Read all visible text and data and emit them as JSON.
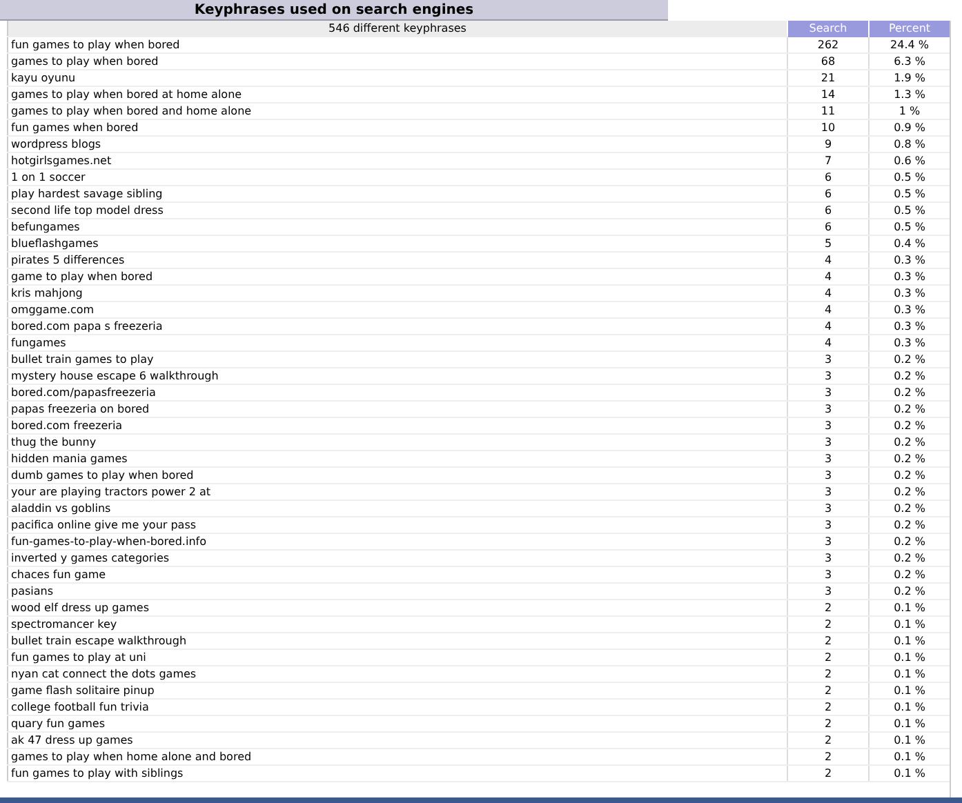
{
  "title": "Keyphrases used on search engines",
  "table": {
    "columns": [
      "546 different keyphrases",
      "Search",
      "Percent"
    ],
    "rows": [
      [
        "fun games to play when bored",
        "262",
        "24.4 %"
      ],
      [
        "games to play when bored",
        "68",
        "6.3 %"
      ],
      [
        "kayu oyunu",
        "21",
        "1.9 %"
      ],
      [
        "games to play when bored at home alone",
        "14",
        "1.3 %"
      ],
      [
        "games to play when bored and home alone",
        "11",
        "1 %"
      ],
      [
        "fun games when bored",
        "10",
        "0.9 %"
      ],
      [
        "wordpress blogs",
        "9",
        "0.8 %"
      ],
      [
        "hotgirlsgames.net",
        "7",
        "0.6 %"
      ],
      [
        "1 on 1 soccer",
        "6",
        "0.5 %"
      ],
      [
        "play hardest savage sibling",
        "6",
        "0.5 %"
      ],
      [
        "second life top model dress",
        "6",
        "0.5 %"
      ],
      [
        "befungames",
        "6",
        "0.5 %"
      ],
      [
        "blueflashgames",
        "5",
        "0.4 %"
      ],
      [
        "pirates 5 differences",
        "4",
        "0.3 %"
      ],
      [
        "game to play when bored",
        "4",
        "0.3 %"
      ],
      [
        "kris mahjong",
        "4",
        "0.3 %"
      ],
      [
        "omggame.com",
        "4",
        "0.3 %"
      ],
      [
        "bored.com papa s freezeria",
        "4",
        "0.3 %"
      ],
      [
        "fungames",
        "4",
        "0.3 %"
      ],
      [
        "bullet train games to play",
        "3",
        "0.2 %"
      ],
      [
        "mystery house escape 6 walkthrough",
        "3",
        "0.2 %"
      ],
      [
        "bored.com/papasfreezeria",
        "3",
        "0.2 %"
      ],
      [
        "papas freezeria on bored",
        "3",
        "0.2 %"
      ],
      [
        "bored.com freezeria",
        "3",
        "0.2 %"
      ],
      [
        "thug the bunny",
        "3",
        "0.2 %"
      ],
      [
        "hidden mania games",
        "3",
        "0.2 %"
      ],
      [
        "dumb games to play when bored",
        "3",
        "0.2 %"
      ],
      [
        "your are playing tractors power 2 at",
        "3",
        "0.2 %"
      ],
      [
        "aladdin vs goblins",
        "3",
        "0.2 %"
      ],
      [
        "pacifica online give me your pass",
        "3",
        "0.2 %"
      ],
      [
        "fun-games-to-play-when-bored.info",
        "3",
        "0.2 %"
      ],
      [
        "inverted y games categories",
        "3",
        "0.2 %"
      ],
      [
        "chaces fun game",
        "3",
        "0.2 %"
      ],
      [
        "pasians",
        "3",
        "0.2 %"
      ],
      [
        "wood elf dress up games",
        "2",
        "0.1 %"
      ],
      [
        "spectromancer key",
        "2",
        "0.1 %"
      ],
      [
        "bullet train escape walkthrough",
        "2",
        "0.1 %"
      ],
      [
        "fun games to play at uni",
        "2",
        "0.1 %"
      ],
      [
        "nyan cat connect the dots games",
        "2",
        "0.1 %"
      ],
      [
        "game flash solitaire pinup",
        "2",
        "0.1 %"
      ],
      [
        "college football fun trivia",
        "2",
        "0.1 %"
      ],
      [
        "quary fun games",
        "2",
        "0.1 %"
      ],
      [
        "ak 47 dress up games",
        "2",
        "0.1 %"
      ],
      [
        "games to play when home alone and bored",
        "2",
        "0.1 %"
      ],
      [
        "fun games to play with siblings",
        "2",
        "0.1 %"
      ]
    ]
  }
}
